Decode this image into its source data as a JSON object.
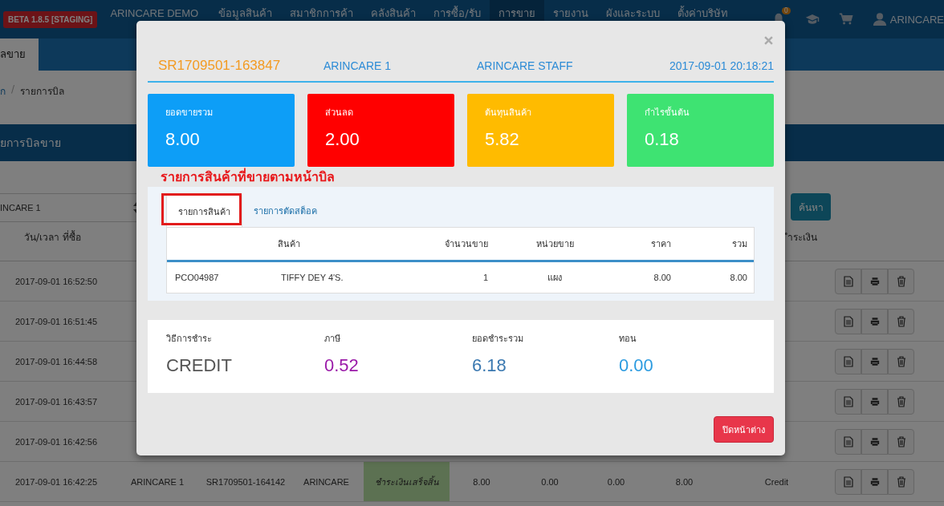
{
  "nav": {
    "badge": "BETA 1.8.5 [STAGING]",
    "brand": "ARINCARE DEMO",
    "menu": [
      {
        "label": "ข้อมูลสินค้า",
        "selected": false
      },
      {
        "label": "สมาชิกการค้า",
        "selected": false
      },
      {
        "label": "คลังสินค้า",
        "selected": false
      },
      {
        "label": "การซื้อ/รับ",
        "selected": false
      },
      {
        "label": "การขาย",
        "selected": true
      },
      {
        "label": "รายงาน",
        "selected": false
      },
      {
        "label": "ผังและระบบ",
        "selected": false
      },
      {
        "label": "ตั้งค่าบริษัท",
        "selected": false
      }
    ],
    "notification_count": "0",
    "user": "ARINCARE"
  },
  "subnav": {
    "tab": "ลขาย"
  },
  "breadcrumb": {
    "home": "ก",
    "separator": "/",
    "current": "รายการบิล"
  },
  "section_title": "ยการบิลขาย",
  "filter": {
    "branch": "INCARE 1",
    "search_button": "ค้นหา"
  },
  "table": {
    "columns": {
      "date": "วัน/เวลา ที่ซื้อ",
      "payment": "ำระเงิน"
    },
    "rows": [
      {
        "date": "2017-09-01 16:52:50"
      },
      {
        "date": "2017-09-01 16:51:45"
      },
      {
        "date": "2017-09-01 16:44:58"
      },
      {
        "date": "2017-09-01 16:43:57"
      },
      {
        "date": "2017-09-01 16:42:56"
      },
      {
        "date": "2017-09-01 16:42:25",
        "branch": "ARINCARE 1",
        "bill_no": "SR1709501-164142",
        "staff": "ARINCARE",
        "status": "ชำระเงินเสร็จสิ้น",
        "subtotal": "8.00",
        "discount": "0.00",
        "tax": "0.00",
        "total": "8.00",
        "payment": "Credit"
      }
    ]
  },
  "modal": {
    "bill_no": "SR1709501-163847",
    "branch": "ARINCARE 1",
    "staff": "ARINCARE STAFF",
    "datetime": "2017-09-01 20:18:21",
    "summary": [
      {
        "label": "ยอดขายรวม",
        "value": "8.00",
        "color": "#0d9ef7"
      },
      {
        "label": "ส่วนลด",
        "value": "2.00",
        "color": "#ff0000"
      },
      {
        "label": "ต้นทุนสินค้า",
        "value": "5.82",
        "color": "#ffbb00"
      },
      {
        "label": "กำไรขั้นต้น",
        "value": "0.18",
        "color": "#3ee372"
      }
    ],
    "annotation": "รายการสินค้าที่ขายตามหน้าบิล",
    "tabs": [
      {
        "label": "รายการสินค้า",
        "selected": true
      },
      {
        "label": "รายการตัดสต็อค",
        "selected": false
      }
    ],
    "items": {
      "columns": [
        "",
        "สินค้า",
        "จำนวนขาย",
        "หน่วยขาย",
        "ราคา",
        "รวม"
      ],
      "rows": [
        [
          "PCO04987",
          "TIFFY DEY 4'S.",
          "1",
          "แผง",
          "8.00",
          "8.00"
        ]
      ]
    },
    "payment": [
      {
        "label": "วิธีการชำระ",
        "value": "CREDIT",
        "color": "#555555"
      },
      {
        "label": "ภาษี",
        "value": "0.52",
        "color": "#9a1aa8"
      },
      {
        "label": "ยอดชำระรวม",
        "value": "6.18",
        "color": "#3a78b0"
      },
      {
        "label": "ทอน",
        "value": "0.00",
        "color": "#2b9be0"
      }
    ],
    "close_button": "ปิดหน้าต่าง"
  }
}
